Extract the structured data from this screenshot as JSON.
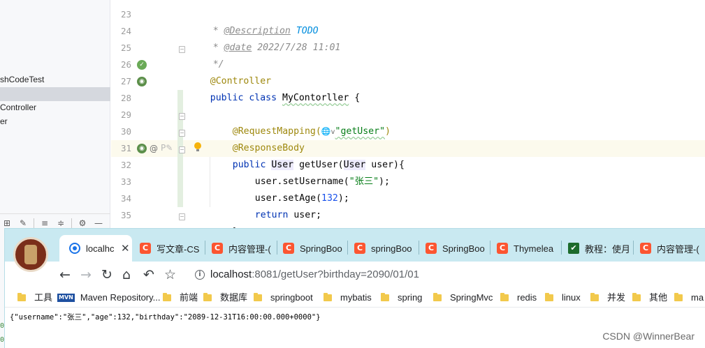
{
  "project_panel": {
    "items": [
      "shCodeTest",
      "Controller",
      "er"
    ]
  },
  "editor": {
    "line_numbers": [
      "23",
      "24",
      "25",
      "26",
      "27",
      "28",
      "29",
      "30",
      "31",
      "32",
      "33",
      "34",
      "35"
    ],
    "lines": {
      "l23": {
        "star": " * ",
        "tag": "@Description",
        "sp": " ",
        "todo": "TODO"
      },
      "l24": {
        "star": " * ",
        "tag": "@date",
        "rest": " 2022/7/28 11:01"
      },
      "l25": {
        "text": " */"
      },
      "l26": {
        "ann": "@Controller"
      },
      "l27": {
        "kw": "public class",
        "sp": " ",
        "cls": "MyContorller",
        "rest": " {"
      },
      "l29": {
        "ann": "@RequestMapping(",
        "globe": "🌐",
        "v": "v",
        "str": "\"getUser\"",
        "close": ")"
      },
      "l30": {
        "ann": "@ResponseBody"
      },
      "l31": {
        "kw": "public",
        "sp1": " ",
        "type1": "User",
        "mid": " getUser(",
        "type2": "User",
        "end": " user){"
      },
      "l32": {
        "pre": "user.setUsername(",
        "str": "\"张三\"",
        "post": ");"
      },
      "l33": {
        "pre": "user.setAge(",
        "num": "132",
        "post": ");"
      },
      "l34": {
        "kw": "return",
        "rest": " user;"
      },
      "l35": {
        "text": "}"
      }
    }
  },
  "browser": {
    "tabs": [
      {
        "label": "localhc",
        "favicon": "globe",
        "active": true,
        "close": "✕"
      },
      {
        "label": "写文章-CS",
        "favicon": "C"
      },
      {
        "label": "内容管理-(",
        "favicon": "C"
      },
      {
        "label": "SpringBoo",
        "favicon": "C"
      },
      {
        "label": "springBoo",
        "favicon": "C"
      },
      {
        "label": "SpringBoo",
        "favicon": "C"
      },
      {
        "label": "Thymelea",
        "favicon": "C"
      },
      {
        "label": "教程：使月",
        "favicon": "check"
      },
      {
        "label": "内容管理-(",
        "favicon": "C"
      }
    ],
    "url": {
      "host": "localhost",
      "rest": ":8081/getUser?birthday=2090/01/01"
    },
    "bookmarks": [
      "工具",
      "Maven Repository...",
      "前端",
      "数据库",
      "springboot",
      "mybatis",
      "spring",
      "SpringMvc",
      "redis",
      "linux",
      "并发",
      "其他",
      "ma"
    ],
    "page_json": "{\"username\":\"张三\",\"age\":132,\"birthday\":\"2089-12-31T16:00:00.000+0000\"}"
  },
  "watermark": "CSDN @WinnerBear"
}
